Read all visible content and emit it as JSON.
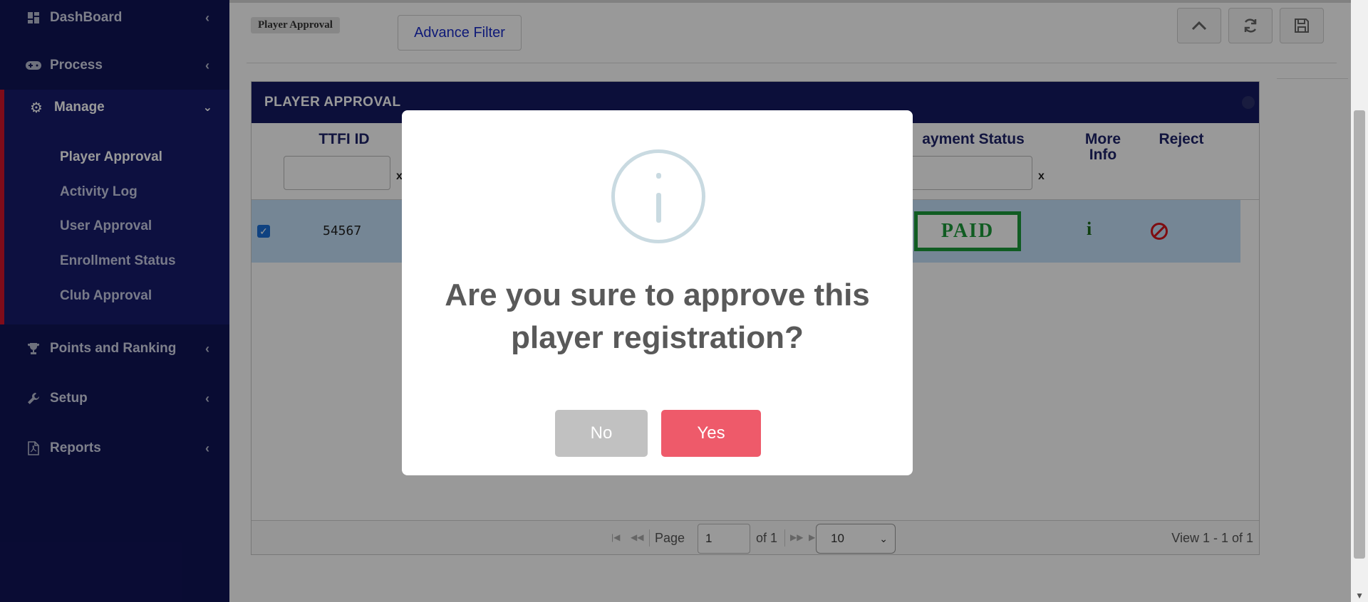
{
  "sidebar": {
    "items": [
      {
        "label": "DashBoard",
        "icon": "dashboard-icon"
      },
      {
        "label": "Process",
        "icon": "gamepad-icon"
      },
      {
        "label": "Manage",
        "icon": "gear-icon"
      },
      {
        "label": "Points and Ranking",
        "icon": "trophy-icon"
      },
      {
        "label": "Setup",
        "icon": "wrench-icon"
      },
      {
        "label": "Reports",
        "icon": "pdf-file-icon"
      }
    ],
    "manage_sub": [
      "Player Approval",
      "Activity Log",
      "User Approval",
      "Enrollment Status",
      "Club Approval"
    ]
  },
  "header": {
    "breadcrumb": "Player Approval",
    "advance_filter": "Advance Filter"
  },
  "panel": {
    "title": "PLAYER APPROVAL",
    "columns": {
      "ttfi_id": "TTFI ID",
      "payment_status": "ayment Status",
      "more_info_1": "More",
      "more_info_2": "Info",
      "reject": "Reject"
    },
    "filter_clear": "x",
    "row": {
      "ttfi_id": "54567",
      "payment": "PAID",
      "info": "i",
      "checked": true
    }
  },
  "pager": {
    "page_label": "Page",
    "page_value": "1",
    "of_label": "of 1",
    "rows_per_page": "10",
    "view_text": "View 1 - 1 of 1"
  },
  "modal": {
    "title": "Are you sure to approve this player registration?",
    "no_label": "No",
    "yes_label": "Yes"
  },
  "colors": {
    "sidebar_bg": "#101456",
    "panel_header": "#141a62",
    "accent_red": "#d4142c",
    "paid_green": "#1c9a3a",
    "yes_button": "#ee5a6a",
    "no_button": "#c1c1c1"
  }
}
